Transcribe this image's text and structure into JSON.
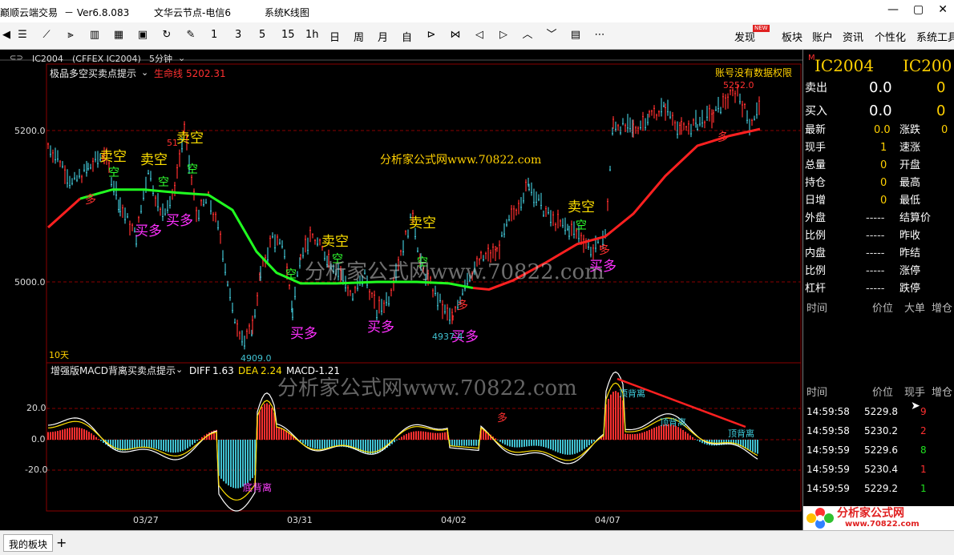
{
  "window": {
    "app_title": "巅顺云端交易",
    "version": "－ Ver6.8.083",
    "server": "文华云节点-电信6",
    "menu": "系统K线图"
  },
  "toolbar": {
    "icons": [
      "menu-lines-icon",
      "line-chart-icon",
      "candle-icon",
      "bar-chart-icon",
      "grid-icon",
      "save-icon",
      "refresh-icon",
      "draw-icon"
    ],
    "periods": [
      "1",
      "3",
      "5",
      "15",
      "1h",
      "日",
      "周",
      "月",
      "自"
    ],
    "nav_icons": [
      "zoom-in-icon",
      "zoom-out-icon",
      "left-icon",
      "right-icon",
      "up-icon",
      "down-icon",
      "layout-icon",
      "more-icon"
    ],
    "menus": [
      "发现",
      "板块",
      "账户",
      "资讯",
      "个性化",
      "系统工具"
    ],
    "new_badge": "NEW"
  },
  "chart_header": {
    "symbol": "IC2004",
    "exchange": "(CFFEX IC2004)",
    "period": "5分钟"
  },
  "main_chart": {
    "indicator": "极品多空买卖点提示",
    "life_label": "生命线",
    "life_value": "5202.31",
    "no_permission": "账号没有数据权限",
    "y_ticks": [
      "5200.0",
      "5000.0"
    ],
    "high_label": "5252.0",
    "low_label_1": "4909.0",
    "low_label_2": "4937.4",
    "days_label": "10天",
    "watermark": "分析家公式网www.70822.com",
    "signals": {
      "sell": "卖空",
      "buy": "买多",
      "short": "空",
      "long": "多"
    }
  },
  "macd": {
    "title": "增强版MACD背离买卖点提示",
    "diff_label": "DIFF",
    "diff_value": "1.63",
    "dea_label": "DEA",
    "dea_value": "2.24",
    "macd_label": "MACD",
    "macd_value": "-1.21",
    "y_ticks": [
      "20.0",
      "0.0",
      "-20.0"
    ],
    "divergence_top": "顶背离",
    "divergence_bottom": "底背离",
    "watermark": "分析家公式网www.70822.com",
    "long_mark": "多"
  },
  "x_ticks": [
    "03/27",
    "03/31",
    "04/02",
    "04/07"
  ],
  "quote": {
    "symbol": "IC2004",
    "symbol_repeat": "IC200",
    "ask": {
      "label": "卖出",
      "price": "0.0",
      "vol": "0"
    },
    "bid": {
      "label": "买入",
      "price": "0.0",
      "vol": "0"
    },
    "rows": [
      {
        "l": "最新",
        "v": "0.0",
        "r": "涨跌",
        "rv": "0"
      },
      {
        "l": "现手",
        "v": "1",
        "r": "速涨",
        "rv": ""
      },
      {
        "l": "总量",
        "v": "0",
        "r": "开盘",
        "rv": ""
      },
      {
        "l": "持仓",
        "v": "0",
        "r": "最高",
        "rv": ""
      },
      {
        "l": "日增",
        "v": "0",
        "r": "最低",
        "rv": ""
      },
      {
        "l": "外盘",
        "v": "-----",
        "r": "结算价",
        "rv": ""
      },
      {
        "l": "比例",
        "v": "-----",
        "r": "昨收",
        "rv": ""
      },
      {
        "l": "内盘",
        "v": "-----",
        "r": "昨结",
        "rv": ""
      },
      {
        "l": "比例",
        "v": "-----",
        "r": "涨停",
        "rv": ""
      },
      {
        "l": "杠杆",
        "v": "-----",
        "r": "跌停",
        "rv": ""
      }
    ],
    "bigorder_headers": [
      "时间",
      "价位",
      "大单",
      "增仓"
    ],
    "tick_headers": [
      "时间",
      "价位",
      "现手",
      "增仓"
    ],
    "ticks": [
      {
        "time": "14:59:58",
        "price": "5229.8",
        "vol": "9",
        "color": "#ff3030"
      },
      {
        "time": "14:59:58",
        "price": "5230.2",
        "vol": "2",
        "color": "#ff3030"
      },
      {
        "time": "14:59:59",
        "price": "5229.6",
        "vol": "8",
        "color": "#20e020"
      },
      {
        "time": "14:59:59",
        "price": "5230.4",
        "vol": "1",
        "color": "#ff3030"
      },
      {
        "time": "14:59:59",
        "price": "5229.2",
        "vol": "1",
        "color": "#20e020"
      }
    ]
  },
  "statusbar": {
    "tab": "我的板块",
    "add": "+"
  },
  "logo": {
    "name": "分析家公式网",
    "url": "www.70822.com"
  },
  "colors": {
    "up": "#ff3030",
    "down": "#40c0d0",
    "life_up": "#ff2020",
    "life_down": "#20ff20",
    "yellow": "#ffe000",
    "magenta": "#ff30ff",
    "grid": "#8a0000"
  }
}
